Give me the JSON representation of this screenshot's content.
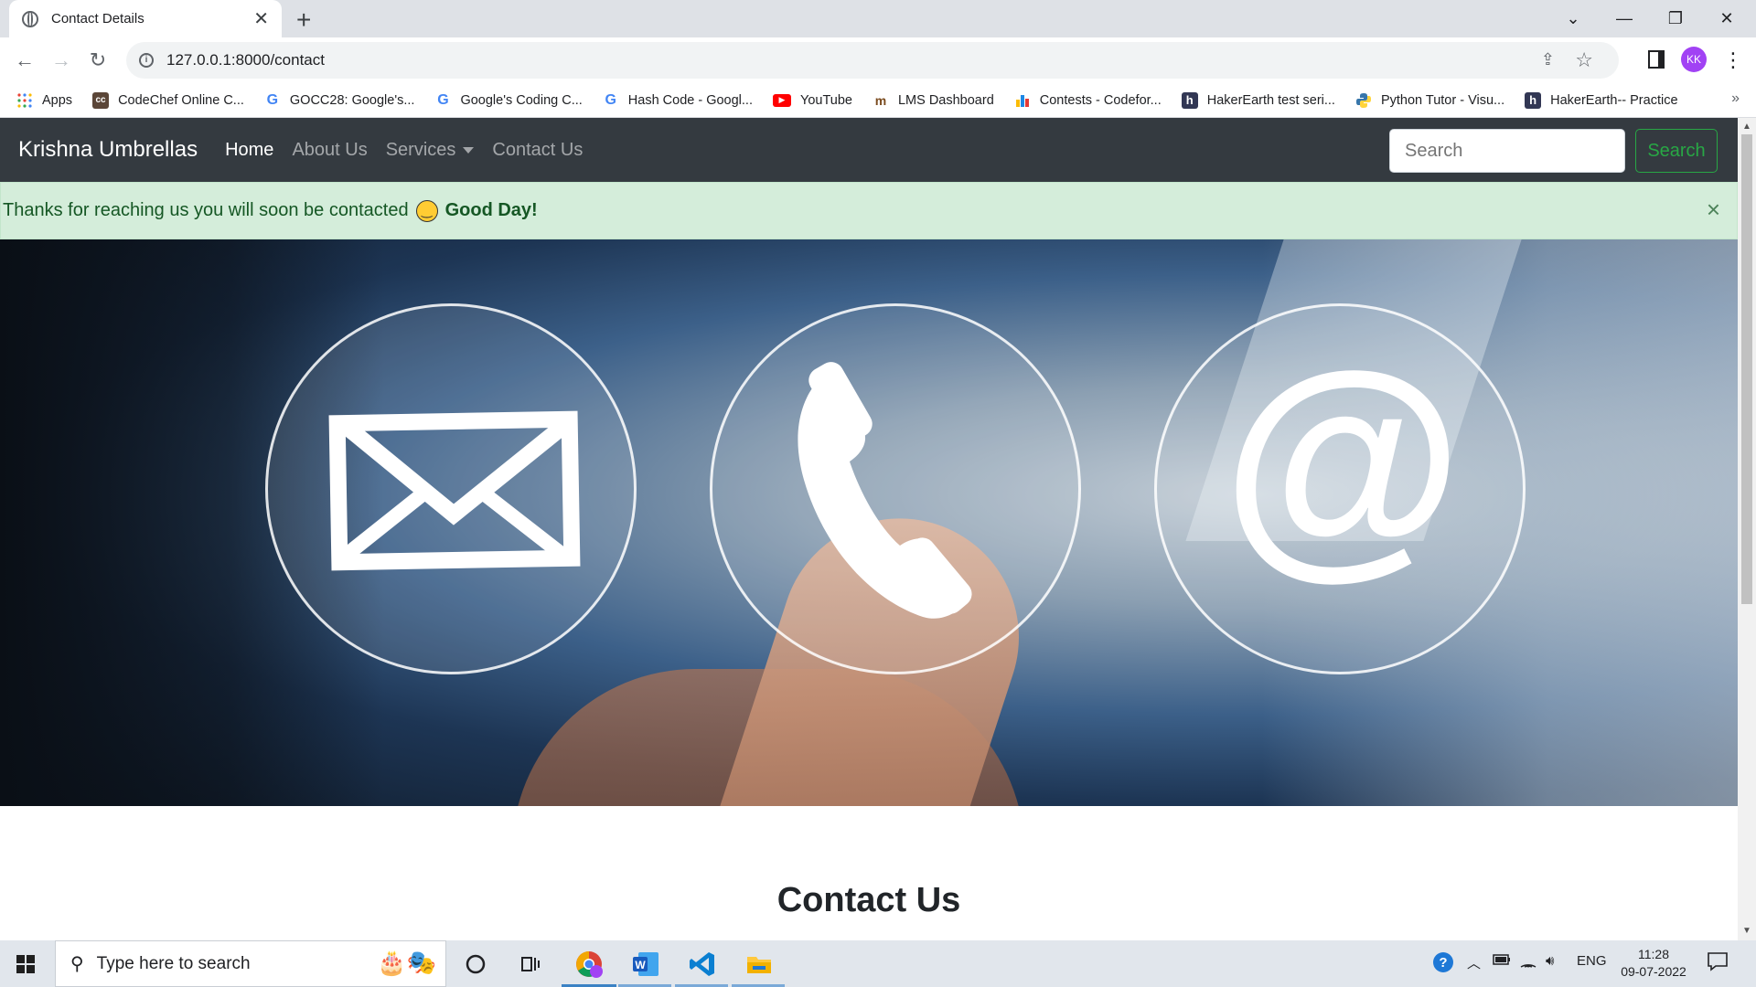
{
  "browser": {
    "tab_title": "Contact Details",
    "url": "127.0.0.1:8000/contact",
    "profile_initials": "KK"
  },
  "bookmarks": [
    {
      "label": "Apps",
      "icon": "apps-grid-icon"
    },
    {
      "label": "CodeChef Online C...",
      "icon": "codechef-icon"
    },
    {
      "label": "GOCC28: Google's...",
      "icon": "google-icon"
    },
    {
      "label": "Google's Coding C...",
      "icon": "google-icon"
    },
    {
      "label": "Hash Code - Googl...",
      "icon": "google-icon"
    },
    {
      "label": "YouTube",
      "icon": "youtube-icon"
    },
    {
      "label": "LMS Dashboard",
      "icon": "lms-icon"
    },
    {
      "label": "Contests - Codefor...",
      "icon": "codeforces-icon"
    },
    {
      "label": "HakerEarth test seri...",
      "icon": "hackerearth-icon"
    },
    {
      "label": "Python Tutor - Visu...",
      "icon": "python-icon"
    },
    {
      "label": "HakerEarth-- Practice",
      "icon": "hackerearth-icon"
    }
  ],
  "site": {
    "brand": "Krishna Umbrellas",
    "nav": {
      "home": "Home",
      "about": "About Us",
      "services": "Services",
      "contact": "Contact Us"
    },
    "search_placeholder": "Search",
    "search_button": "Search"
  },
  "alert": {
    "message": "Thanks for reaching us you will soon be contacted",
    "emphasis": "Good Day!",
    "close": "×"
  },
  "hero_icons": [
    "mail-icon",
    "phone-icon",
    "at-sign-icon"
  ],
  "page": {
    "heading": "Contact Us"
  },
  "taskbar": {
    "search_placeholder": "Type here to search",
    "language": "ENG",
    "time": "11:28",
    "date": "09-07-2022"
  },
  "colors": {
    "navbar_bg": "#343a40",
    "alert_bg": "#d4edda",
    "alert_text": "#155724",
    "success": "#28a745"
  }
}
